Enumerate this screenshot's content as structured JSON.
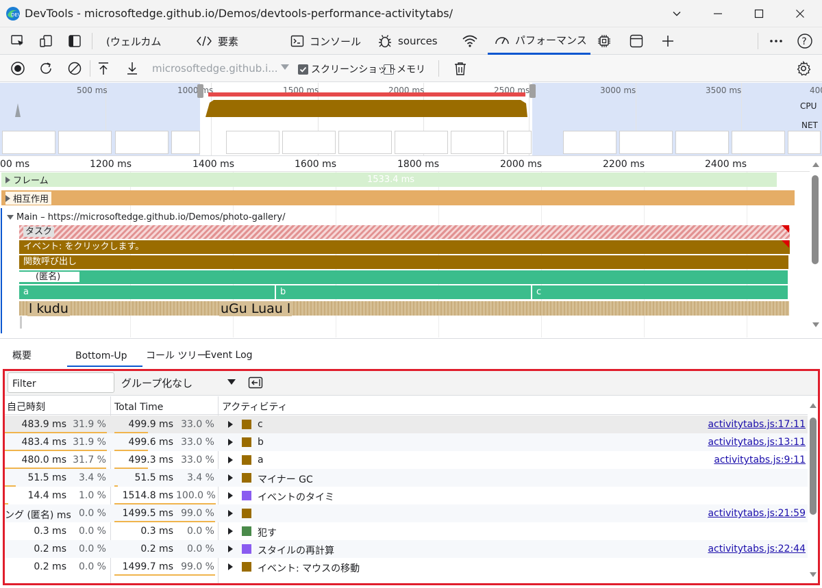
{
  "window": {
    "title": "DevTools - microsoftedge.github.io/Demos/devtools-performance-activitytabs/"
  },
  "tabs": [
    {
      "label": "(ウェルカム"
    },
    {
      "label": "要素"
    },
    {
      "label": "コンソール"
    },
    {
      "label": "sources"
    },
    {
      "label": "パフォーマンス"
    }
  ],
  "toolbar": {
    "url": "microsoftedge.github.i...",
    "screenshots_label": "スクリーンショット",
    "screenshots_checked": true,
    "memory_label": "メモリ",
    "memory_checked": false
  },
  "overview": {
    "ticks": [
      "500 ms",
      "1000 ms",
      "1500 ms",
      "2000 ms",
      "2500 ms",
      "3000 ms",
      "3500 ms",
      "400"
    ],
    "cpu_label": "CPU",
    "net_label": "NET"
  },
  "timeline": {
    "ruler_ticks": [
      "00 ms",
      "1200 ms",
      "1400 ms",
      "1600 ms",
      "1800 ms",
      "2000 ms",
      "2200 ms",
      "2400 ms"
    ],
    "frames_label": "フレーム",
    "frames_duration": "1533.4 ms",
    "interactions_label": "相互作用",
    "main_label": "Main – https://microsoftedge.github.io/Demos/photo-gallery/",
    "task_label": "タスク",
    "event_label": "イベント: をクリックします。",
    "function_call_label": "関数呼び出し",
    "anonymous_label": "(匿名)",
    "func_a": "a",
    "func_b": "b",
    "func_c": "c",
    "leaf_1": "l kudu",
    "leaf_2": "uGu Luau l"
  },
  "bottom_tabs": {
    "summary": "概要",
    "bottom_up": "Bottom-Up",
    "call_tree": "コール ツリー",
    "event_log": "Event Log"
  },
  "panel": {
    "filter_placeholder": "Filter",
    "grouping": "グループ化なし",
    "col_self_time": "自己時刻",
    "col_total_time": "Total Time",
    "col_activity": "アクティビティ"
  },
  "rows": [
    {
      "self": "483.9 ms",
      "self_pct": "31.9 %",
      "total": "499.9 ms",
      "total_pct": "33.0 %",
      "name": "c",
      "color": "#9a6c00",
      "link": "activitytabs.js:17:11",
      "self_frac": 0.319,
      "total_frac": 0.33
    },
    {
      "self": "483.4 ms",
      "self_pct": "31.9 %",
      "total": "499.6 ms",
      "total_pct": "33.0 %",
      "name": "b",
      "color": "#9a6c00",
      "link": "activitytabs.js:13:11",
      "self_frac": 0.319,
      "total_frac": 0.33
    },
    {
      "self": "480.0 ms",
      "self_pct": "31.7 %",
      "total": "499.3 ms",
      "total_pct": "33.0 %",
      "name": "a",
      "color": "#9a6c00",
      "link": "activitytabs.js:9:11",
      "self_frac": 0.317,
      "total_frac": 0.33
    },
    {
      "self": "51.5 ms",
      "self_pct": "3.4 %",
      "total": "51.5 ms",
      "total_pct": "3.4 %",
      "name": "マイナー GC",
      "color": "#9a6c00",
      "link": "",
      "self_frac": 0.034,
      "total_frac": 0.034
    },
    {
      "self": "14.4 ms",
      "self_pct": "1.0 %",
      "total": "1514.8 ms",
      "total_pct": "100.0 %",
      "name": "イベントのタイミ",
      "color": "#8a5cf0",
      "link": "",
      "self_frac": 0.01,
      "total_frac": 1.0
    },
    {
      "self": "ング (匿名) ms",
      "self_pct": "0.0 %",
      "total": "1499.5 ms",
      "total_pct": "99.0 %",
      "name": "",
      "color": "#9a6c00",
      "link": "activitytabs.js:21:59",
      "self_frac": 0,
      "total_frac": 0.99
    },
    {
      "self": "0.3 ms",
      "self_pct": "0.0 %",
      "total": "0.3 ms",
      "total_pct": "0.0 %",
      "name": "犯す",
      "color": "#4a8a4a",
      "link": "",
      "self_frac": 0,
      "total_frac": 0
    },
    {
      "self": "0.2 ms",
      "self_pct": "0.0 %",
      "total": "0.2 ms",
      "total_pct": "0.0 %",
      "name": "スタイルの再計算",
      "color": "#8a5cf0",
      "link": "activitytabs.js:22:44",
      "self_frac": 0,
      "total_frac": 0
    },
    {
      "self": "0.2 ms",
      "self_pct": "0.0 %",
      "total": "1499.7 ms",
      "total_pct": "99.0 %",
      "name": "イベント: マウスの移動",
      "color": "#9a6c00",
      "link": "",
      "self_frac": 0,
      "total_frac": 0.99
    }
  ],
  "colors": {
    "accent": "#0b57d0",
    "highlight_frame": "#e01e2c",
    "scripting": "#9a6c00",
    "rendering": "#8a5cf0",
    "js_frame": "#3bbd8c",
    "interactions": "#e5ad66",
    "frames": "#d6f0d0"
  }
}
